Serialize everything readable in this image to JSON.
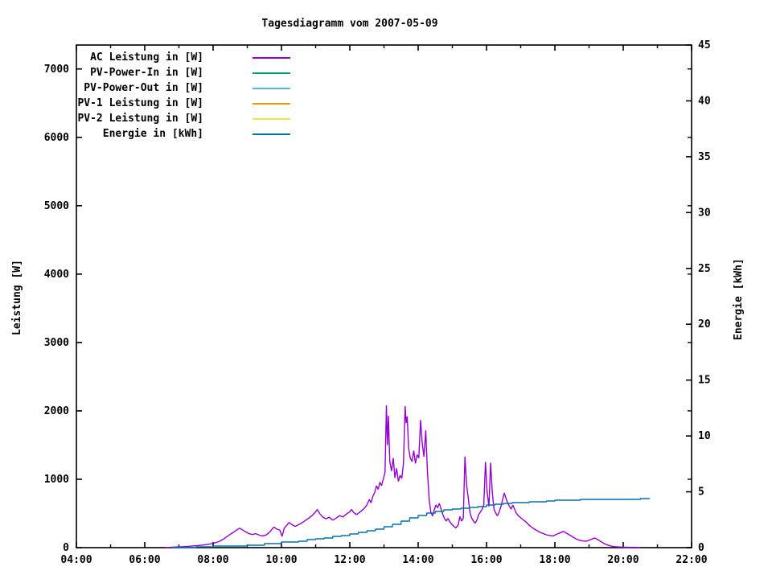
{
  "title": "Tagesdiagramm vom 2007-05-09",
  "chart_data": {
    "type": "line",
    "title": "Tagesdiagramm vom 2007-05-09",
    "grid": false,
    "legend_position": "top-left-inside",
    "x_axis": {
      "min_hour": 4,
      "max_hour": 22,
      "major_tick_hours": [
        4,
        6,
        8,
        10,
        12,
        14,
        16,
        18,
        20,
        22
      ],
      "major_tick_labels": [
        "04:00",
        "06:00",
        "08:00",
        "10:00",
        "12:00",
        "14:00",
        "16:00",
        "18:00",
        "20:00",
        "22:00"
      ],
      "minor_tick_hours": [
        5,
        7,
        9,
        11,
        13,
        15,
        17,
        19,
        21
      ]
    },
    "y1_axis": {
      "label": "Leistung [W]",
      "min": 0,
      "max": 7350,
      "ticks": [
        0,
        1000,
        2000,
        3000,
        4000,
        5000,
        6000,
        7000
      ]
    },
    "y2_axis": {
      "label": "Energie [kWh]",
      "min": 0,
      "max": 45,
      "ticks": [
        0,
        5,
        10,
        15,
        20,
        25,
        30,
        35,
        40,
        45
      ]
    },
    "legend": [
      {
        "label": "AC Leistung in [W]",
        "color": "#9400d3"
      },
      {
        "label": "PV-Power-In in [W]",
        "color": "#009e73"
      },
      {
        "label": "PV-Power-Out in [W]",
        "color": "#56b4e9"
      },
      {
        "label": "PV-1 Leistung in [W]",
        "color": "#e69f00"
      },
      {
        "label": "PV-2 Leistung in [W]",
        "color": "#f0e442"
      },
      {
        "label": "Energie in [kWh]",
        "color": "#0072b2"
      }
    ],
    "series": [
      {
        "name": "AC Leistung in [W]",
        "color": "#9400d3",
        "axis": "y1",
        "step": false,
        "points": [
          [
            6.6,
            2
          ],
          [
            6.75,
            5
          ],
          [
            6.9,
            9
          ],
          [
            7.1,
            14
          ],
          [
            7.3,
            20
          ],
          [
            7.5,
            28
          ],
          [
            7.7,
            38
          ],
          [
            7.9,
            52
          ],
          [
            8.0,
            62
          ],
          [
            8.1,
            78
          ],
          [
            8.2,
            95
          ],
          [
            8.3,
            125
          ],
          [
            8.4,
            160
          ],
          [
            8.5,
            195
          ],
          [
            8.6,
            225
          ],
          [
            8.7,
            262
          ],
          [
            8.78,
            285
          ],
          [
            8.85,
            262
          ],
          [
            8.95,
            232
          ],
          [
            9.05,
            205
          ],
          [
            9.15,
            192
          ],
          [
            9.25,
            205
          ],
          [
            9.35,
            182
          ],
          [
            9.45,
            172
          ],
          [
            9.55,
            185
          ],
          [
            9.65,
            225
          ],
          [
            9.72,
            268
          ],
          [
            9.78,
            300
          ],
          [
            9.85,
            275
          ],
          [
            9.95,
            258
          ],
          [
            10.02,
            165
          ],
          [
            10.08,
            282
          ],
          [
            10.15,
            325
          ],
          [
            10.22,
            368
          ],
          [
            10.3,
            338
          ],
          [
            10.4,
            312
          ],
          [
            10.5,
            335
          ],
          [
            10.6,
            362
          ],
          [
            10.7,
            398
          ],
          [
            10.8,
            432
          ],
          [
            10.9,
            472
          ],
          [
            11.0,
            525
          ],
          [
            11.05,
            558
          ],
          [
            11.12,
            498
          ],
          [
            11.2,
            452
          ],
          [
            11.3,
            422
          ],
          [
            11.4,
            445
          ],
          [
            11.5,
            402
          ],
          [
            11.6,
            432
          ],
          [
            11.7,
            468
          ],
          [
            11.8,
            448
          ],
          [
            11.9,
            492
          ],
          [
            12.0,
            525
          ],
          [
            12.05,
            558
          ],
          [
            12.12,
            512
          ],
          [
            12.2,
            482
          ],
          [
            12.3,
            522
          ],
          [
            12.4,
            562
          ],
          [
            12.5,
            625
          ],
          [
            12.57,
            705
          ],
          [
            12.62,
            655
          ],
          [
            12.68,
            758
          ],
          [
            12.73,
            808
          ],
          [
            12.78,
            905
          ],
          [
            12.83,
            852
          ],
          [
            12.88,
            958
          ],
          [
            12.93,
            905
          ],
          [
            12.98,
            1005
          ],
          [
            13.03,
            1102
          ],
          [
            13.07,
            2082
          ],
          [
            13.1,
            1500
          ],
          [
            13.13,
            1930
          ],
          [
            13.17,
            1260
          ],
          [
            13.22,
            1120
          ],
          [
            13.27,
            1310
          ],
          [
            13.32,
            1020
          ],
          [
            13.37,
            1160
          ],
          [
            13.42,
            968
          ],
          [
            13.47,
            1060
          ],
          [
            13.52,
            1010
          ],
          [
            13.57,
            1230
          ],
          [
            13.62,
            2068
          ],
          [
            13.65,
            1820
          ],
          [
            13.68,
            1920
          ],
          [
            13.72,
            1450
          ],
          [
            13.77,
            1310
          ],
          [
            13.82,
            1260
          ],
          [
            13.87,
            1420
          ],
          [
            13.92,
            1230
          ],
          [
            13.97,
            1360
          ],
          [
            14.02,
            1310
          ],
          [
            14.07,
            1868
          ],
          [
            14.12,
            1520
          ],
          [
            14.17,
            1330
          ],
          [
            14.22,
            1715
          ],
          [
            14.27,
            1120
          ],
          [
            14.32,
            720
          ],
          [
            14.37,
            520
          ],
          [
            14.42,
            462
          ],
          [
            14.47,
            552
          ],
          [
            14.52,
            625
          ],
          [
            14.57,
            582
          ],
          [
            14.62,
            648
          ],
          [
            14.67,
            565
          ],
          [
            14.72,
            488
          ],
          [
            14.77,
            428
          ],
          [
            14.82,
            388
          ],
          [
            14.87,
            428
          ],
          [
            14.92,
            382
          ],
          [
            14.97,
            352
          ],
          [
            15.03,
            318
          ],
          [
            15.1,
            288
          ],
          [
            15.17,
            328
          ],
          [
            15.22,
            455
          ],
          [
            15.27,
            388
          ],
          [
            15.32,
            428
          ],
          [
            15.37,
            1332
          ],
          [
            15.42,
            905
          ],
          [
            15.47,
            705
          ],
          [
            15.52,
            505
          ],
          [
            15.57,
            428
          ],
          [
            15.62,
            388
          ],
          [
            15.67,
            358
          ],
          [
            15.72,
            405
          ],
          [
            15.77,
            482
          ],
          [
            15.82,
            522
          ],
          [
            15.87,
            562
          ],
          [
            15.92,
            625
          ],
          [
            15.97,
            1252
          ],
          [
            16.02,
            808
          ],
          [
            16.07,
            605
          ],
          [
            16.12,
            1242
          ],
          [
            16.17,
            805
          ],
          [
            16.22,
            565
          ],
          [
            16.27,
            505
          ],
          [
            16.32,
            465
          ],
          [
            16.37,
            522
          ],
          [
            16.42,
            602
          ],
          [
            16.47,
            702
          ],
          [
            16.52,
            798
          ],
          [
            16.57,
            722
          ],
          [
            16.62,
            652
          ],
          [
            16.67,
            605
          ],
          [
            16.72,
            562
          ],
          [
            16.77,
            622
          ],
          [
            16.82,
            562
          ],
          [
            16.87,
            502
          ],
          [
            16.95,
            458
          ],
          [
            17.05,
            418
          ],
          [
            17.15,
            378
          ],
          [
            17.25,
            328
          ],
          [
            17.35,
            288
          ],
          [
            17.45,
            258
          ],
          [
            17.55,
            228
          ],
          [
            17.65,
            208
          ],
          [
            17.75,
            188
          ],
          [
            17.85,
            178
          ],
          [
            17.95,
            172
          ],
          [
            18.05,
            195
          ],
          [
            18.15,
            215
          ],
          [
            18.25,
            238
          ],
          [
            18.32,
            218
          ],
          [
            18.42,
            188
          ],
          [
            18.52,
            158
          ],
          [
            18.62,
            128
          ],
          [
            18.72,
            108
          ],
          [
            18.82,
            98
          ],
          [
            18.92,
            95
          ],
          [
            19.02,
            112
          ],
          [
            19.12,
            132
          ],
          [
            19.17,
            142
          ],
          [
            19.25,
            118
          ],
          [
            19.35,
            88
          ],
          [
            19.45,
            58
          ],
          [
            19.55,
            38
          ],
          [
            19.65,
            22
          ],
          [
            19.75,
            14
          ],
          [
            19.85,
            10
          ],
          [
            19.95,
            8
          ],
          [
            20.1,
            6
          ],
          [
            20.3,
            5
          ],
          [
            20.5,
            4
          ]
        ]
      },
      {
        "name": "Energie in [kWh]",
        "color": "#0072b2",
        "axis": "y2",
        "step": true,
        "points": [
          [
            6.8,
            0.01
          ],
          [
            7.0,
            0.02
          ],
          [
            7.5,
            0.06
          ],
          [
            8.0,
            0.11
          ],
          [
            8.5,
            0.17
          ],
          [
            9.0,
            0.25
          ],
          [
            9.5,
            0.35
          ],
          [
            10.0,
            0.47
          ],
          [
            10.25,
            0.54
          ],
          [
            10.5,
            0.61
          ],
          [
            10.75,
            0.7
          ],
          [
            11.0,
            0.8
          ],
          [
            11.25,
            0.9
          ],
          [
            11.5,
            1.0
          ],
          [
            11.75,
            1.1
          ],
          [
            12.0,
            1.22
          ],
          [
            12.25,
            1.35
          ],
          [
            12.5,
            1.5
          ],
          [
            12.75,
            1.67
          ],
          [
            13.0,
            1.87
          ],
          [
            13.25,
            2.12
          ],
          [
            13.5,
            2.38
          ],
          [
            13.75,
            2.64
          ],
          [
            14.0,
            2.88
          ],
          [
            14.25,
            3.1
          ],
          [
            14.5,
            3.26
          ],
          [
            14.75,
            3.38
          ],
          [
            15.0,
            3.47
          ],
          [
            15.25,
            3.55
          ],
          [
            15.5,
            3.62
          ],
          [
            15.75,
            3.7
          ],
          [
            16.0,
            3.79
          ],
          [
            16.25,
            3.87
          ],
          [
            16.5,
            3.94
          ],
          [
            16.75,
            4.0
          ],
          [
            17.0,
            4.05
          ],
          [
            17.25,
            4.1
          ],
          [
            17.5,
            4.14
          ],
          [
            17.75,
            4.18
          ],
          [
            18.0,
            4.22
          ],
          [
            18.25,
            4.25
          ],
          [
            18.5,
            4.27
          ],
          [
            18.75,
            4.29
          ],
          [
            19.0,
            4.31
          ],
          [
            19.25,
            4.32
          ],
          [
            19.5,
            4.33
          ],
          [
            20.0,
            4.35
          ],
          [
            20.5,
            4.36
          ],
          [
            20.78,
            4.36
          ]
        ]
      }
    ]
  }
}
